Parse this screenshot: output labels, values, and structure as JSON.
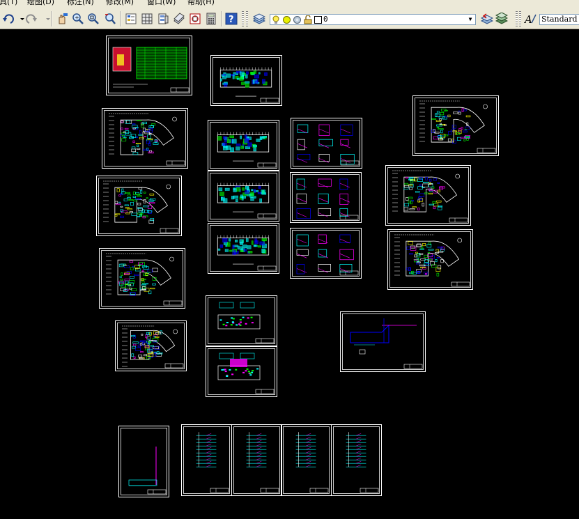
{
  "menu": {
    "items": [
      "具(T)",
      "绘图(D)",
      "标注(N)",
      "修改(M)",
      "窗口(W)",
      "帮助(H)"
    ]
  },
  "toolbar": {
    "layer_value": "0",
    "text_style": "Standard"
  },
  "colors": {
    "background": "#000000",
    "frame": "#ffffff",
    "cyan": "#00ffff",
    "blue": "#0000ff",
    "magenta": "#ff00ff",
    "green": "#00ff00",
    "yellow": "#ffff00",
    "red": "#ff0000"
  },
  "icons": [
    "undo-icon",
    "redo-icon",
    "pan-icon",
    "zoom-realtime-icon",
    "zoom-window-icon",
    "zoom-previous-icon",
    "properties-icon",
    "design-center-icon",
    "tool-palettes-icon",
    "sheet-set-icon",
    "markup-icon",
    "quickcalc-icon",
    "help-icon",
    "layer-manager-icon",
    "lightbulb-icon",
    "sun-icon",
    "freeze-icon",
    "lock-icon",
    "color-box-icon",
    "layer-previous-icon",
    "layer-states-icon",
    "text-style-icon"
  ]
}
